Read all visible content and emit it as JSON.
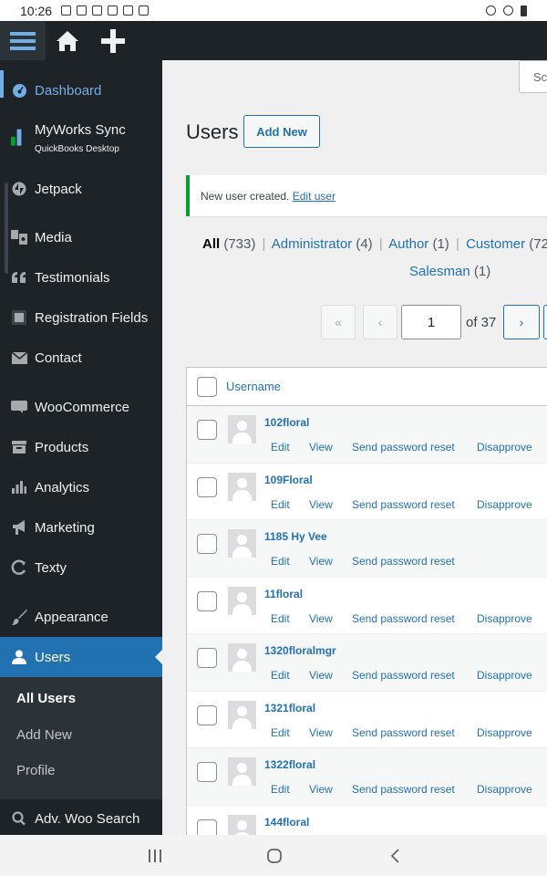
{
  "status_bar": {
    "time": "10:26"
  },
  "sidebar": {
    "items": [
      {
        "label": "Dashboard",
        "icon": "dashboard-icon"
      },
      {
        "label": "MyWorks Sync",
        "sublabel": "QuickBooks Desktop",
        "icon": "myworks-icon"
      },
      {
        "label": "Jetpack",
        "icon": "jetpack-icon"
      },
      {
        "label": "Media",
        "icon": "media-icon"
      },
      {
        "label": "Testimonials",
        "icon": "quote-icon"
      },
      {
        "label": "Registration Fields",
        "icon": "form-icon"
      },
      {
        "label": "Contact",
        "icon": "mail-icon"
      },
      {
        "label": "WooCommerce",
        "icon": "woo-icon"
      },
      {
        "label": "Products",
        "icon": "archive-icon"
      },
      {
        "label": "Analytics",
        "icon": "bar-chart-icon"
      },
      {
        "label": "Marketing",
        "icon": "megaphone-icon"
      },
      {
        "label": "Texty",
        "icon": "texty-icon"
      },
      {
        "label": "Appearance",
        "icon": "brush-icon"
      },
      {
        "label": "Users",
        "icon": "user-icon"
      },
      {
        "label": "Adv. Woo Search",
        "icon": "search-icon"
      }
    ],
    "submenu": [
      "All Users",
      "Add New",
      "Profile"
    ]
  },
  "main": {
    "search_placeholder": "Sc",
    "title": "Users",
    "add_new": "Add New",
    "notice_text": "New user created. ",
    "notice_link": "Edit user",
    "filters": {
      "all": "All",
      "all_count": "(733)",
      "administrator": "Administrator",
      "administrator_count": "(4)",
      "author": "Author",
      "author_count": "(1)",
      "customer": "Customer",
      "customer_count": "(72",
      "salesman": "Salesman",
      "salesman_count": "(1)",
      "separator": "|"
    },
    "pagination": {
      "first": "«",
      "prev": "‹",
      "current": "1",
      "of_label": "of 37",
      "next": "›"
    },
    "table": {
      "column_username": "Username",
      "actions": {
        "edit": "Edit",
        "view": "View",
        "reset": "Send password reset",
        "disapprove": "Disapprove"
      },
      "rows": [
        {
          "username": "102floral",
          "disapprove": true
        },
        {
          "username": "109Floral",
          "disapprove": true
        },
        {
          "username": "1185 Hy Vee",
          "disapprove": false
        },
        {
          "username": "11floral",
          "disapprove": true
        },
        {
          "username": "1320floralmgr",
          "disapprove": true
        },
        {
          "username": "1321floral",
          "disapprove": true
        },
        {
          "username": "1322floral",
          "disapprove": true
        },
        {
          "username": "144floral",
          "disapprove": true
        }
      ]
    }
  }
}
